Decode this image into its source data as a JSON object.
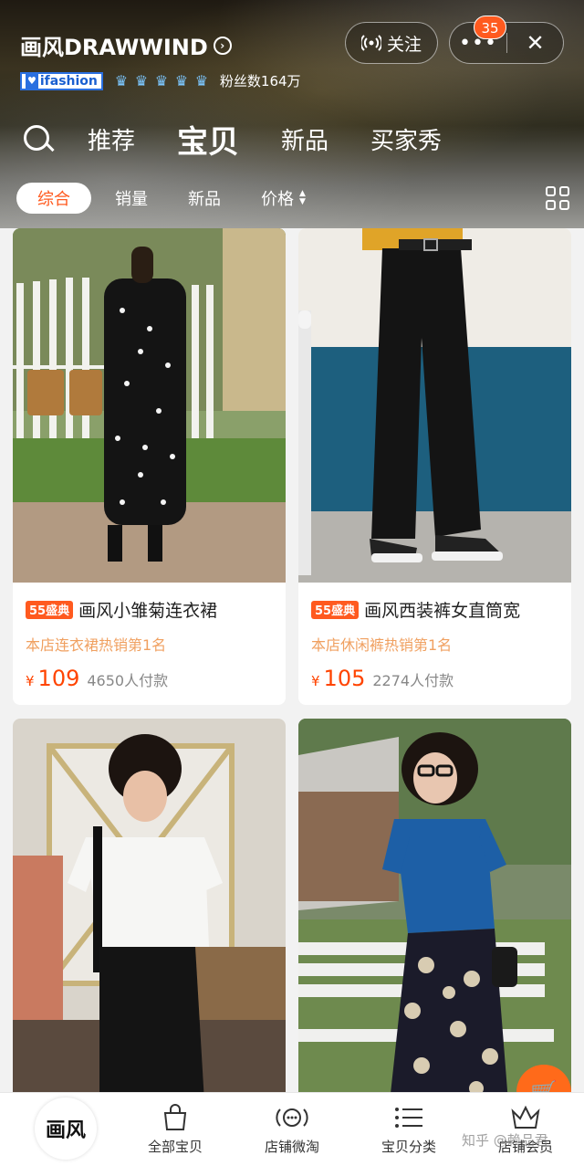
{
  "store": {
    "name": "画风DRAWWIND",
    "ifashion_label": "ifashion",
    "fans": "粉丝数164万"
  },
  "header_actions": {
    "follow_label": "关注",
    "notification_count": "35"
  },
  "nav": {
    "tabs": [
      "推荐",
      "宝贝",
      "新品",
      "买家秀"
    ],
    "active": "宝贝"
  },
  "filters": {
    "items": [
      "综合",
      "销量",
      "新品",
      "价格"
    ],
    "active": "综合"
  },
  "products": [
    {
      "promo": "55盛典",
      "title": "画风小雏菊连衣裙",
      "rank": "本店连衣裙热销第1名",
      "price_symbol": "¥",
      "price": "109",
      "sold": "4650人付款"
    },
    {
      "promo": "55盛典",
      "title": "画风西装裤女直筒宽",
      "rank": "本店休闲裤热销第1名",
      "price_symbol": "¥",
      "price": "105",
      "sold": "2274人付款"
    }
  ],
  "tabbar": {
    "logo_text": "画风",
    "items": [
      "全部宝贝",
      "店铺微淘",
      "宝贝分类",
      "店铺会员"
    ]
  },
  "watermark": "知乎 @赖品君"
}
